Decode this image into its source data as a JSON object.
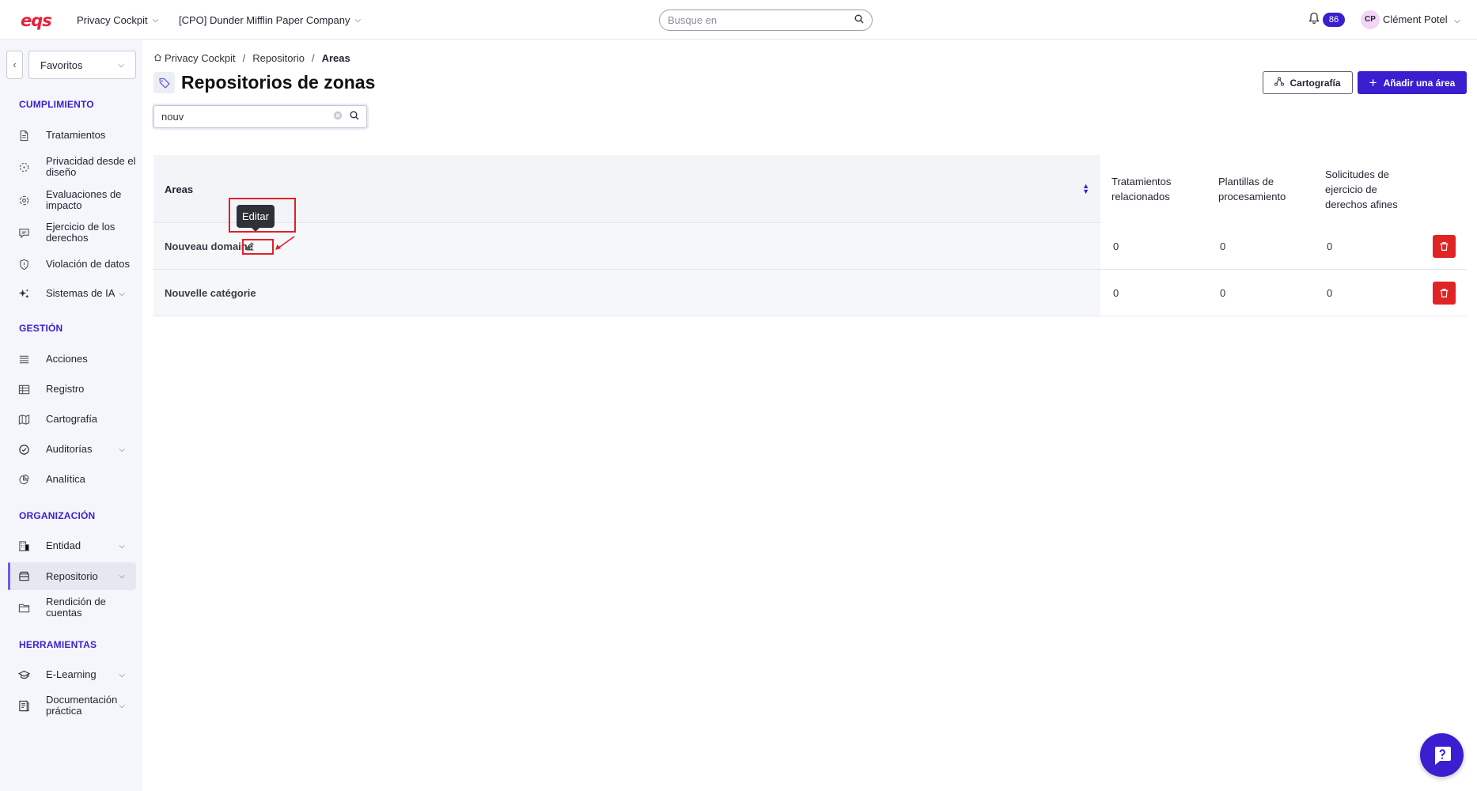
{
  "app": {
    "logo": "eqs",
    "module_label": "Privacy Cockpit",
    "company_label": "[CPO] Dunder Mifflin Paper Company",
    "search_placeholder": "Busque en",
    "notifications_count": "86",
    "user_initials": "CP",
    "user_name": "Clément Potel"
  },
  "sidebar": {
    "favorites_label": "Favoritos",
    "sections": {
      "cumplimiento": "CUMPLIMIENTO",
      "gestion": "GESTIÓN",
      "organizacion": "ORGANIZACIÓN",
      "herramientas": "HERRAMIENTAS"
    },
    "items": {
      "tratamientos": "Tratamientos",
      "privacidad": "Privacidad desde el diseño",
      "evaluaciones": "Evaluaciones de impacto",
      "ejercicio": "Ejercicio de los derechos",
      "violacion": "Violación de datos",
      "sistemas_ia": "Sistemas de IA",
      "acciones": "Acciones",
      "registro": "Registro",
      "cartografia": "Cartografía",
      "auditorias": "Auditorías",
      "analitica": "Analítica",
      "entidad": "Entidad",
      "repositorio": "Repositorio",
      "rendicion": "Rendición de cuentas",
      "elearning": "E-Learning",
      "documentacion": "Documentación práctica"
    },
    "active_item": "repositorio"
  },
  "breadcrumb": {
    "home": "Privacy Cockpit",
    "parent": "Repositorio",
    "current": "Areas"
  },
  "page": {
    "title": "Repositorios de zonas",
    "cartografia_button": "Cartografía",
    "add_button": "Añadir una área",
    "filter_value": "nouv"
  },
  "table": {
    "headers": {
      "areas": "Areas",
      "tratamientos": "Tratamientos relacionados",
      "plantillas": "Plantillas de procesamiento",
      "solicitudes": "Solicitudes de ejercicio de derechos afines"
    },
    "rows": [
      {
        "name": "Nouveau domaine",
        "tratamientos": "0",
        "plantillas": "0",
        "solicitudes": "0"
      },
      {
        "name": "Nouvelle catégorie",
        "tratamientos": "0",
        "plantillas": "0",
        "solicitudes": "0"
      }
    ]
  },
  "tooltip": {
    "text": "Editar"
  },
  "colors": {
    "brand": "#3a1fd1",
    "logo": "#e8203a",
    "danger": "#e02424",
    "annotation": "#e0202a"
  }
}
